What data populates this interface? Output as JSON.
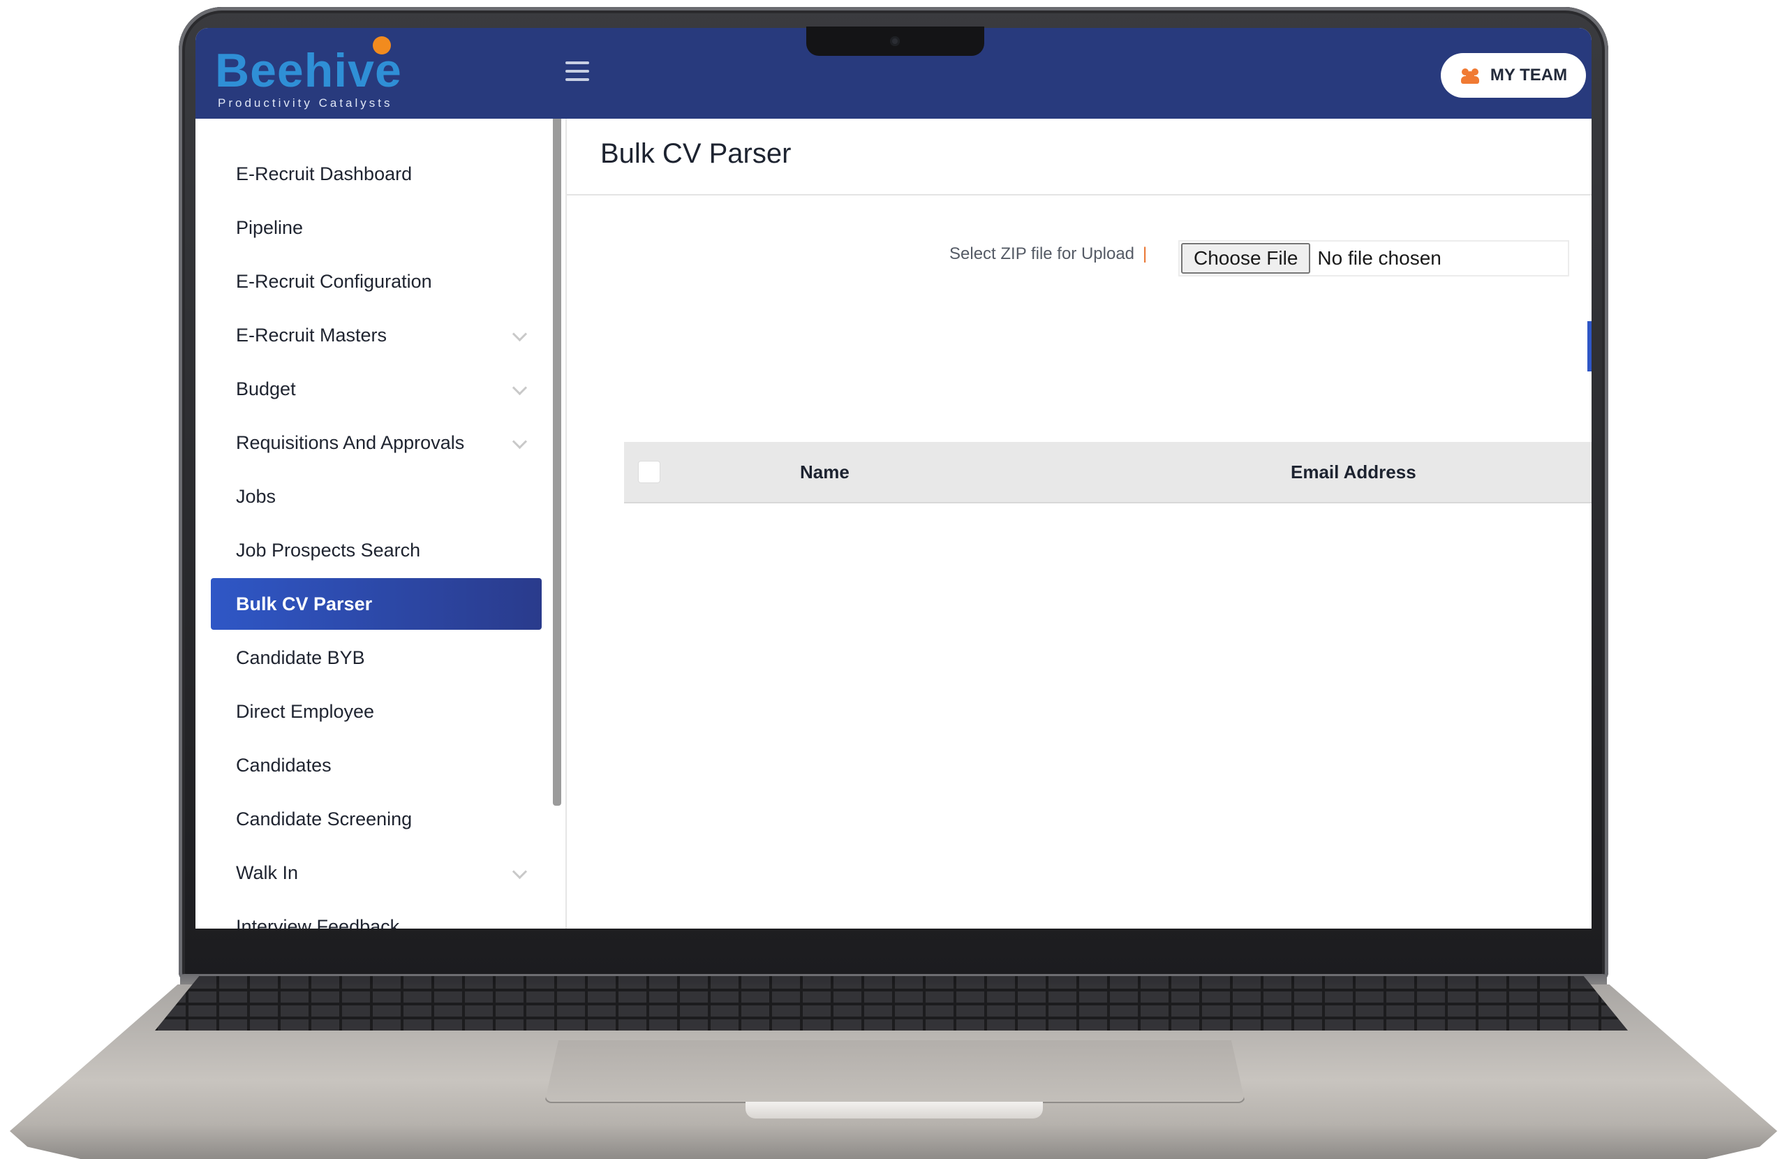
{
  "brand": {
    "name": "Beehive",
    "tagline": "Productivity Catalysts",
    "colors": {
      "topbar": "#283a7d",
      "logo": "#2f8fd6",
      "accent": "#f28b1e",
      "active": "#2f57c6"
    }
  },
  "header": {
    "menu_icon": "hamburger-icon",
    "team_button": {
      "label": "MY TEAM",
      "icon": "team-icon"
    }
  },
  "sidebar": {
    "items": [
      {
        "label": "E-Recruit Dashboard",
        "expandable": false,
        "active": false
      },
      {
        "label": "Pipeline",
        "expandable": false,
        "active": false
      },
      {
        "label": "E-Recruit Configuration",
        "expandable": false,
        "active": false
      },
      {
        "label": "E-Recruit Masters",
        "expandable": true,
        "active": false
      },
      {
        "label": "Budget",
        "expandable": true,
        "active": false
      },
      {
        "label": "Requisitions And Approvals",
        "expandable": true,
        "active": false
      },
      {
        "label": "Jobs",
        "expandable": false,
        "active": false
      },
      {
        "label": "Job Prospects Search",
        "expandable": false,
        "active": false
      },
      {
        "label": "Bulk CV Parser",
        "expandable": false,
        "active": true
      },
      {
        "label": "Candidate BYB",
        "expandable": false,
        "active": false
      },
      {
        "label": "Direct Employee",
        "expandable": false,
        "active": false
      },
      {
        "label": "Candidates",
        "expandable": false,
        "active": false
      },
      {
        "label": "Candidate Screening",
        "expandable": false,
        "active": false
      },
      {
        "label": "Walk In",
        "expandable": true,
        "active": false
      },
      {
        "label": "Interview Feedback",
        "expandable": false,
        "active": false
      }
    ]
  },
  "main": {
    "title": "Bulk CV Parser",
    "upload": {
      "label": "Select ZIP file for Upload",
      "required_mark": "|",
      "button_label": "Choose File",
      "status": "No file chosen"
    },
    "table": {
      "columns": [
        "Name",
        "Email Address"
      ]
    }
  }
}
